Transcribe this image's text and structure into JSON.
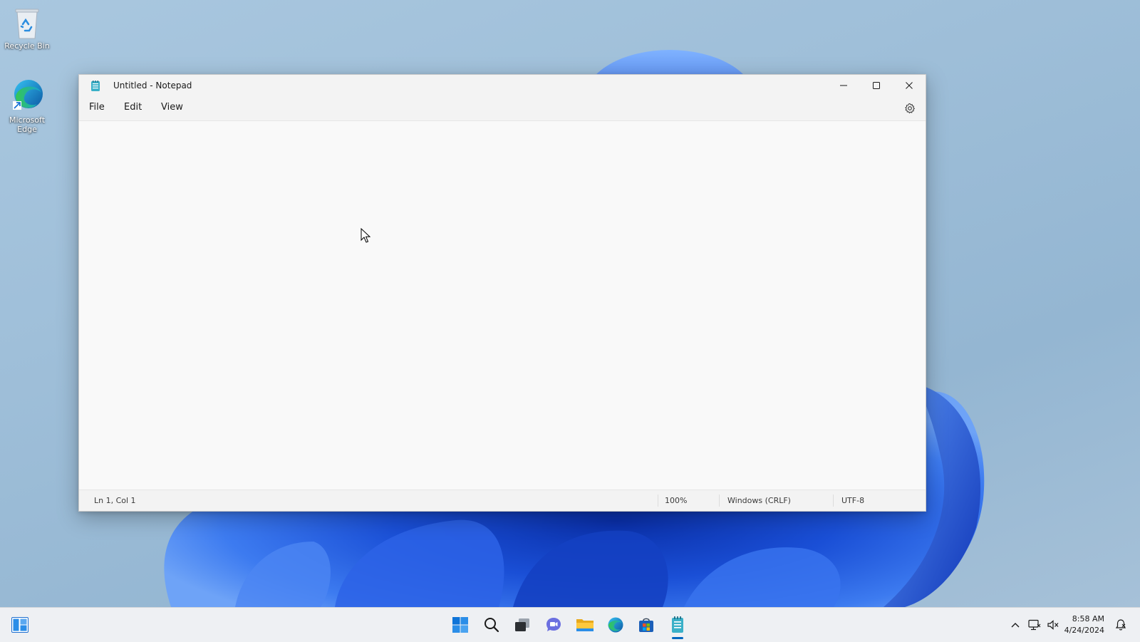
{
  "desktop": {
    "icons": [
      {
        "label": "Recycle Bin"
      },
      {
        "label": "Microsoft Edge"
      }
    ]
  },
  "window": {
    "title": "Untitled - Notepad",
    "menu": [
      "File",
      "Edit",
      "View"
    ],
    "editor_text": "",
    "status": {
      "position": "Ln 1, Col 1",
      "zoom": "100%",
      "line_ending": "Windows (CRLF)",
      "encoding": "UTF-8"
    }
  },
  "taskbar": {
    "apps": [
      "start-icon",
      "search-icon",
      "task-view-icon",
      "chat-icon",
      "file-explorer-icon",
      "edge-icon",
      "store-icon",
      "notepad-icon"
    ],
    "active_app": "notepad-icon",
    "clock": {
      "time": "8:58 AM",
      "date": "4/24/2024"
    }
  },
  "colors": {
    "accent": "#0067c0",
    "bloom": "#1a4fd6"
  }
}
